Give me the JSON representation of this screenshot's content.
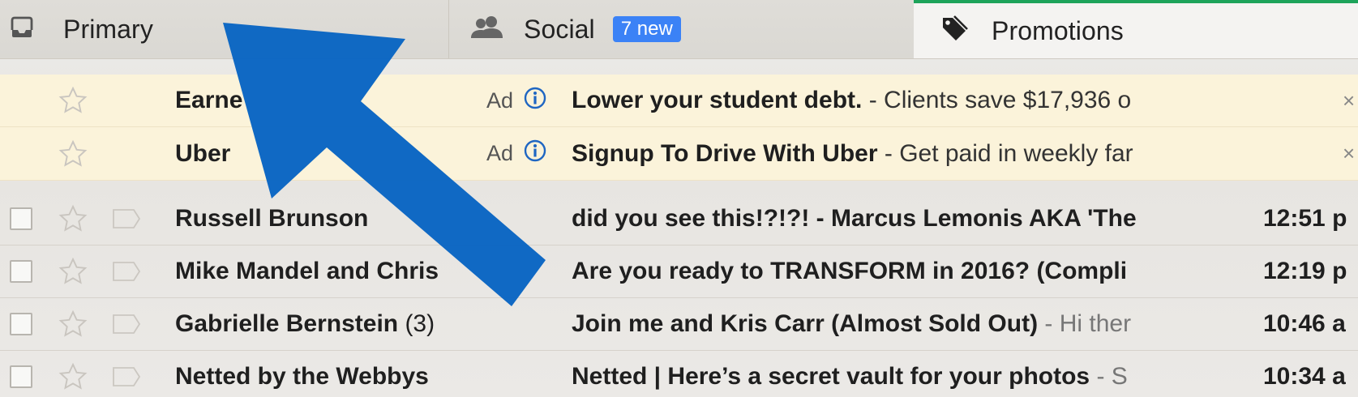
{
  "tabs": {
    "primary": {
      "label": "Primary",
      "icon": "inbox-icon"
    },
    "social": {
      "label": "Social",
      "icon": "people-icon",
      "badge": "7 new"
    },
    "promotions": {
      "label": "Promotions",
      "icon": "tag-icon",
      "active": true
    }
  },
  "ads": [
    {
      "sender": "Earne",
      "ad_label": "Ad",
      "subject": "Lower your student debt.",
      "separator": " - ",
      "snippet": "Clients save $17,936 o"
    },
    {
      "sender": "Uber",
      "ad_label": "Ad",
      "subject": "Signup To Drive With Uber",
      "separator": " - ",
      "snippet": "Get paid in weekly far"
    }
  ],
  "emails": [
    {
      "sender": "Russell Brunson",
      "count": "",
      "subject": "did you see this!?!?! - Marcus Lemonis AKA 'The",
      "separator": "",
      "snippet": "",
      "time": "12:51 p"
    },
    {
      "sender": "Mike Mandel and Chris",
      "count": "",
      "subject": "Are you ready to TRANSFORM in 2016? (Compli",
      "separator": "",
      "snippet": "",
      "time": "12:19 p"
    },
    {
      "sender": "Gabrielle Bernstein",
      "count": " (3)",
      "subject": "Join me and Kris Carr (Almost Sold Out)",
      "separator": " - ",
      "snippet": "Hi ther",
      "time": "10:46 a"
    },
    {
      "sender": "Netted by the Webbys",
      "count": "",
      "subject": "Netted | Here’s a secret vault for your photos",
      "separator": " - ",
      "snippet": "S",
      "time": "10:34 a"
    }
  ],
  "colors": {
    "promotions_accent": "#1da35a",
    "badge_blue": "#3b82f6",
    "overlay_arrow": "#0b66c3",
    "ad_background": "#fbf3da"
  }
}
